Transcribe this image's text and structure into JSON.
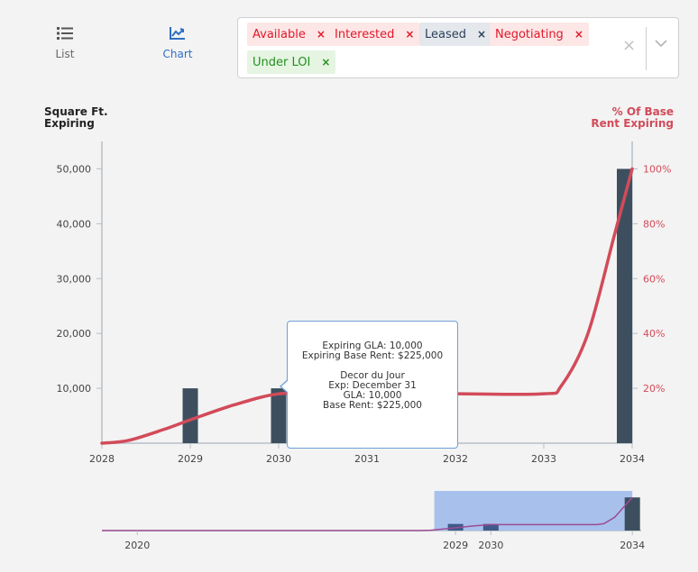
{
  "view_toggle": {
    "list_label": "List",
    "chart_label": "Chart",
    "list_icon": "list-icon",
    "chart_icon": "chart-icon",
    "active": "Chart"
  },
  "filters": {
    "tags": [
      {
        "label": "Available",
        "color": "#e0182a"
      },
      {
        "label": "Interested",
        "color": "#e0182a"
      },
      {
        "label": "Leased",
        "color": "#2c3f58"
      },
      {
        "label": "Negotiating",
        "color": "#e0182a"
      },
      {
        "label": "Under LOI",
        "color": "#23901f"
      }
    ],
    "remove_glyph": "×",
    "clear_glyph": "×",
    "dropdown_icon": "chevron-down-icon"
  },
  "chart_data": {
    "type": "bar",
    "left_axis_title": [
      "Square Ft.",
      "Expiring"
    ],
    "right_axis_title": [
      "% Of Base",
      "Rent Expiring"
    ],
    "x": [
      2028,
      2029,
      2030,
      2031,
      2032,
      2033,
      2034
    ],
    "xlim": [
      2028,
      2034
    ],
    "ylim_left": [
      0,
      55000
    ],
    "left_ticks": [
      10000,
      20000,
      30000,
      40000,
      50000
    ],
    "left_tick_labels": [
      "10,000",
      "20,000",
      "30,000",
      "40,000",
      "50,000"
    ],
    "ylim_right": [
      0,
      110
    ],
    "right_ticks": [
      20,
      40,
      60,
      80,
      100
    ],
    "right_tick_labels": [
      "20%",
      "40%",
      "60%",
      "80%",
      "100%"
    ],
    "series": [
      {
        "type": "bar",
        "color": "#3d4f5f",
        "points": [
          [
            2029,
            10000
          ],
          [
            2030,
            10000
          ],
          [
            2034,
            50000
          ]
        ]
      },
      {
        "type": "line",
        "color": "#d24b5a",
        "points": [
          [
            2028,
            0
          ],
          [
            2028.3,
            1
          ],
          [
            2028.7,
            5
          ],
          [
            2029,
            8.5
          ],
          [
            2029.5,
            14
          ],
          [
            2030,
            18
          ],
          [
            2030.5,
            18
          ],
          [
            2031,
            18
          ],
          [
            2032,
            18
          ],
          [
            2033,
            18
          ],
          [
            2033.2,
            21
          ],
          [
            2033.5,
            40
          ],
          [
            2033.8,
            76
          ],
          [
            2034,
            100
          ]
        ]
      }
    ],
    "navigator": {
      "x_ticks": [
        2020,
        2029,
        2030,
        2034
      ],
      "xlim": [
        2019,
        2034.25
      ],
      "selected_range": [
        2028.4,
        2034
      ],
      "selection_color": "#a8c1ec",
      "line_color": "#9b4c93"
    }
  },
  "tooltip": {
    "lines_summary": [
      "Expiring GLA: 10,000",
      "Expiring Base Rent: $225,000"
    ],
    "lines_detail": [
      "Decor du Jour",
      "Exp: December 31",
      "GLA: 10,000",
      "Base Rent: $225,000"
    ]
  }
}
